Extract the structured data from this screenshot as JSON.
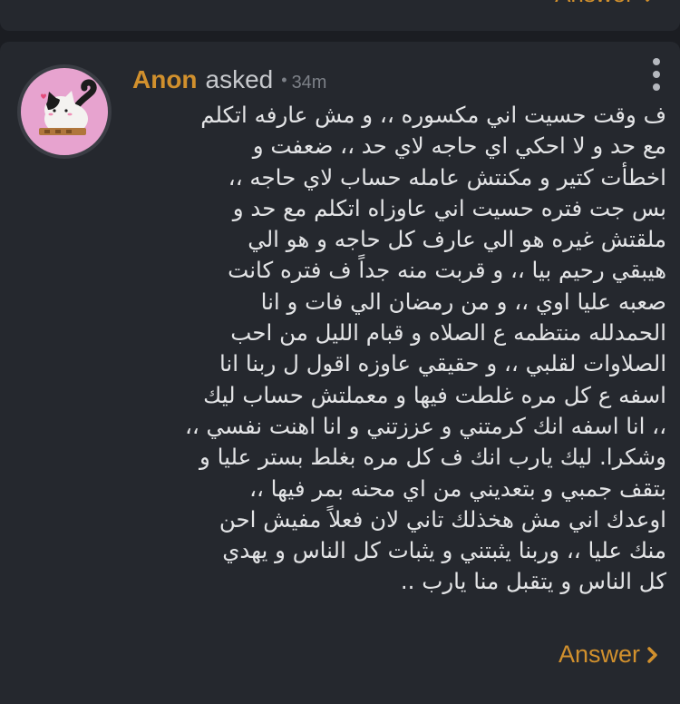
{
  "previous_card": {
    "answer_label": "Answer"
  },
  "question": {
    "author": "Anon",
    "verb": "asked",
    "separator": "•",
    "time": "34m",
    "lines": [
      "ف وقت حسيت اني مكسوره ،، و مش عارفه اتكلم",
      "مع حد و لا احكي اي حاجه لاي حد ،، ضعفت و",
      "اخطأت كتير و مكنتش عامله حساب لاي حاجه ،،",
      "بس جت فتره حسيت اني عاوزاه اتكلم مع حد و",
      "ملقتش غيره هو الي عارف كل حاجه و هو الي",
      "هيبقي رحيم بيا ،، و قربت منه جداً ف فتره كانت",
      "صعبه عليا اوي ،، و من رمضان الي فات و انا",
      "الحمدلله منتظمه ع الصلاه و قبام الليل من احب",
      "الصلاوات لقلبي ،، و حقيقي عاوزه اقول ل ربنا انا",
      "اسفه ع كل مره غلطت فيها و معملتش حساب ليك",
      "،، انا اسفه انك كرمتني و عززتني و انا اهنت نفسي ،،",
      "وشكرا. ليك يارب انك ف كل مره بغلط بستر عليا و",
      "بتقف جمبي و بتعديني من اي محنه بمر فيها ،،",
      "اوعدك اني مش هخذلك تاني لان فعلاً مفيش احن",
      "منك عليا ،، وربنا يثبتني و يثبات كل الناس و يهدي",
      "كل الناس و يتقبل منا يارب .."
    ],
    "answer_label": "Answer"
  },
  "icons": {
    "menu": "more-vertical-icon",
    "chevron": "chevron-right-icon",
    "avatar": "cat-avatar"
  },
  "colors": {
    "background": "#1b1d22",
    "card": "#25282e",
    "accent": "#d1902d",
    "text": "#e3e4e6",
    "muted": "#7c8087",
    "avatar_bg": "#e7a3cf"
  }
}
